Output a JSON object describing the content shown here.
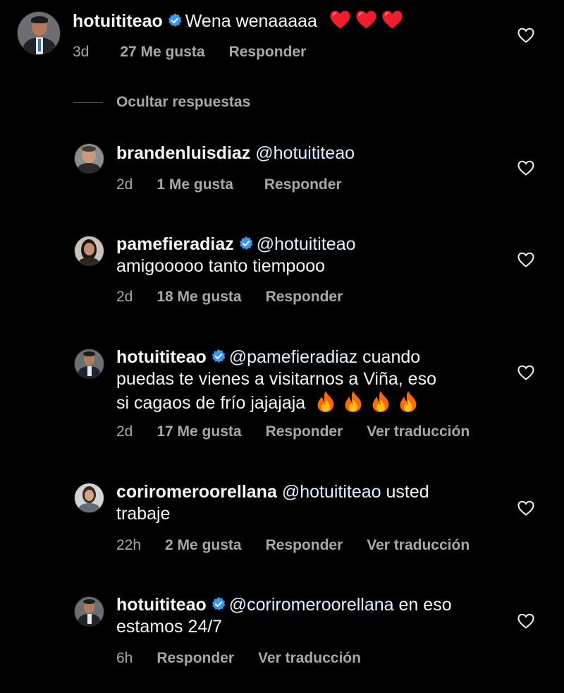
{
  "top_comment": {
    "username": "hotuititeao",
    "text": "Wena wenaaaaa",
    "emoji": [
      "red-heart",
      "red-heart",
      "red-heart"
    ],
    "time": "3d",
    "likes": "27 Me gusta",
    "reply": "Responder"
  },
  "hide_replies": "Ocultar respuestas",
  "replies": [
    {
      "username": "brandenluisdiaz",
      "mention": "@hotuititeao",
      "text": "",
      "time": "2d",
      "likes": "1 Me gusta",
      "reply": "Responder"
    },
    {
      "username": "pamefieradiaz",
      "mention": "@hotuititeao",
      "text": "amigooooo tanto tiempooo",
      "time": "2d",
      "likes": "18 Me gusta",
      "reply": "Responder"
    },
    {
      "username": "hotuititeao",
      "mention": "@pamefieradiaz",
      "text_line1": "cuando",
      "text_line2": "puedas te vienes a visitarnos a Viña, eso",
      "text_line3": "si cagaos de frío jajajaja",
      "emoji": [
        "fire",
        "fire",
        "fire",
        "fire"
      ],
      "time": "2d",
      "likes": "17 Me gusta",
      "reply": "Responder",
      "translate": "Ver traducción"
    },
    {
      "username": "coriromeroorellana",
      "mention": "@hotuititeao",
      "text_line1": "usted",
      "text_line2": "trabaje",
      "time": "22h",
      "likes": "2 Me gusta",
      "reply": "Responder",
      "translate": "Ver traducción"
    },
    {
      "username": "hotuititeao",
      "mention": "@coriromeroorellana",
      "text_line1": "en eso",
      "text_line2": "estamos 24/7",
      "time": "6h",
      "reply": "Responder",
      "translate": "Ver traducción"
    }
  ],
  "colors": {
    "background": "#000000",
    "text": "#f5f5f5",
    "secondary": "#a8a8a8",
    "verified": "#3897f0",
    "mention": "#e0f1ff"
  }
}
